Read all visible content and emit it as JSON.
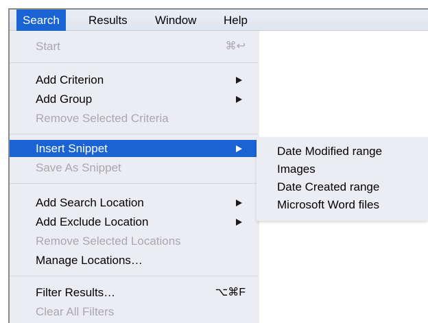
{
  "menubar": {
    "items": [
      "Search",
      "Results",
      "Window",
      "Help"
    ],
    "active": "Search"
  },
  "search_menu": {
    "start": {
      "label": "Start",
      "shortcut": "⌘↩",
      "enabled": false
    },
    "add_criterion": {
      "label": "Add Criterion",
      "enabled": true
    },
    "add_group": {
      "label": "Add Group",
      "enabled": true
    },
    "remove_selected_criteria": {
      "label": "Remove Selected Criteria",
      "enabled": false
    },
    "insert_snippet": {
      "label": "Insert Snippet",
      "enabled": true,
      "highlighted": true
    },
    "save_as_snippet": {
      "label": "Save As Snippet",
      "enabled": false
    },
    "add_search_location": {
      "label": "Add Search Location",
      "enabled": true
    },
    "add_exclude_location": {
      "label": "Add Exclude Location",
      "enabled": true
    },
    "remove_selected_locations": {
      "label": "Remove Selected Locations",
      "enabled": false
    },
    "manage_locations": {
      "label": "Manage Locations…",
      "enabled": true
    },
    "filter_results": {
      "label": "Filter Results…",
      "shortcut": "⌥⌘F",
      "enabled": true
    },
    "clear_all_filters": {
      "label": "Clear All Filters",
      "enabled": false
    }
  },
  "snippet_submenu": {
    "items": [
      "Date Modified range",
      "Images",
      "Date Created range",
      "Microsoft Word files"
    ]
  },
  "colors": {
    "highlight": "#1a63d4",
    "menu_bg": "#ecedf3",
    "disabled_text": "#a8a8ad"
  }
}
